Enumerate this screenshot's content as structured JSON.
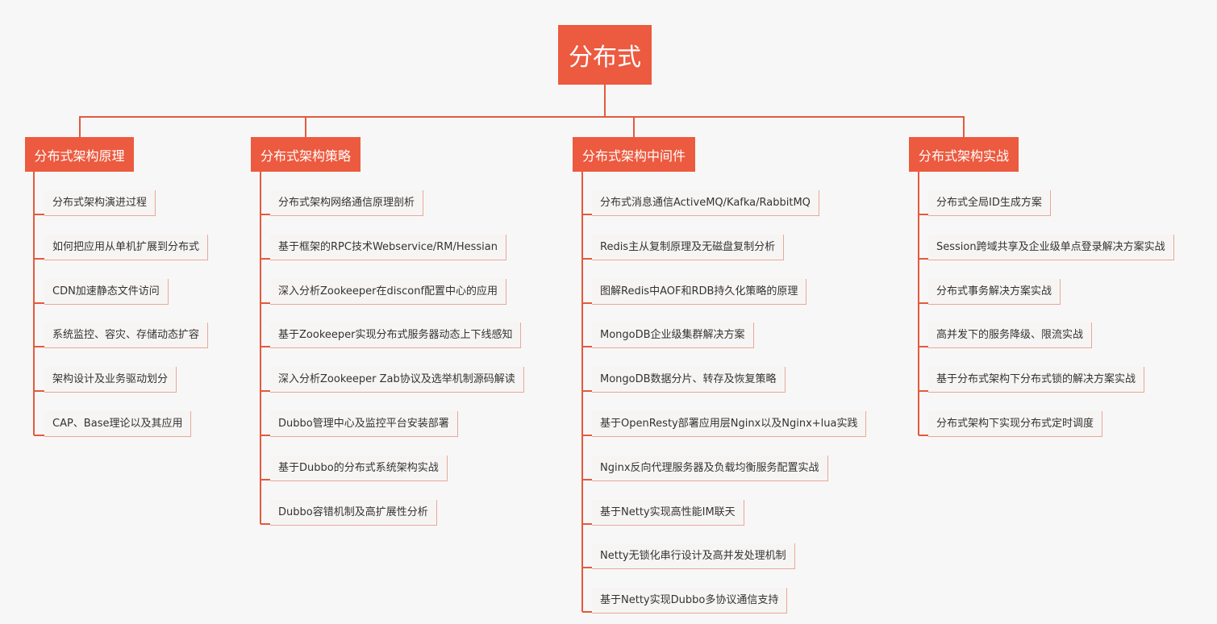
{
  "root": {
    "label": "分布式"
  },
  "colors": {
    "accent": "#ec5a3f",
    "line": "#e35a3d",
    "leaf_bg": "#f7f5f4"
  },
  "branches": [
    {
      "label": "分布式架构原理",
      "items": [
        "分布式架构演进过程",
        "如何把应用从单机扩展到分布式",
        "CDN加速静态文件访问",
        "系统监控、容灾、存储动态扩容",
        "架构设计及业务驱动划分",
        "CAP、Base理论以及其应用"
      ]
    },
    {
      "label": "分布式架构策略",
      "items": [
        "分布式架构网络通信原理剖析",
        "基于框架的RPC技术Webservice/RM/Hessian",
        "深入分析Zookeeper在disconf配置中心的应用",
        "基于Zookeeper实现分布式服务器动态上下线感知",
        "深入分析Zookeeper Zab协议及选举机制源码解读",
        "Dubbo管理中心及监控平台安装部署",
        "基于Dubbo的分布式系统架构实战",
        "Dubbo容错机制及高扩展性分析"
      ]
    },
    {
      "label": "分布式架构中间件",
      "items": [
        "分布式消息通信ActiveMQ/Kafka/RabbitMQ",
        "Redis主从复制原理及无磁盘复制分析",
        "图解Redis中AOF和RDB持久化策略的原理",
        "MongoDB企业级集群解决方案",
        "MongoDB数据分片、转存及恢复策略",
        "基于OpenResty部署应用层Nginx以及Nginx+lua实践",
        "Nginx反向代理服务器及负载均衡服务配置实战",
        "基于Netty实现高性能IM联天",
        "Netty无锁化串行设计及高并发处理机制",
        "基于Netty实现Dubbo多协议通信支持"
      ]
    },
    {
      "label": "分布式架构实战",
      "items": [
        "分布式全局ID生成方案",
        "Session跨域共享及企业级单点登录解决方案实战",
        "分布式事务解决方案实战",
        "高并发下的服务降级、限流实战",
        "基于分布式架构下分布式锁的解决方案实战",
        "分布式架构下实现分布式定时调度"
      ]
    }
  ]
}
